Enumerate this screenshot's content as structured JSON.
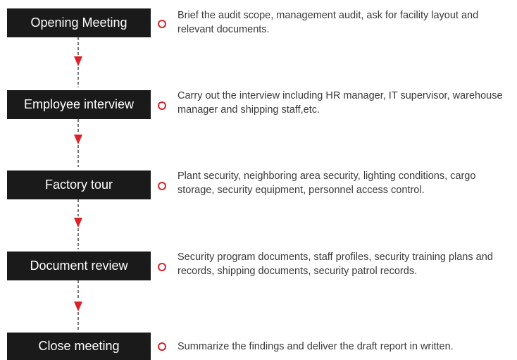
{
  "steps": [
    {
      "label": "Opening Meeting",
      "description": "Brief the audit scope, management audit, ask for facility layout and relevant documents."
    },
    {
      "label": "Employee interview",
      "description": "Carry out the interview including HR manager, IT supervisor, warehouse manager and shipping staff,etc."
    },
    {
      "label": "Factory tour",
      "description": "Plant security, neighboring area security, lighting conditions, cargo storage, security equipment, personnel access control."
    },
    {
      "label": "Document review",
      "description": "Security program documents, staff profiles, security training plans and records, shipping documents, security patrol records."
    },
    {
      "label": "Close meeting",
      "description": "Summarize the findings and deliver the draft report in written."
    }
  ],
  "colors": {
    "box": "#1a1a1a",
    "accent": "#d8232a",
    "text": "#3a3a3a"
  }
}
